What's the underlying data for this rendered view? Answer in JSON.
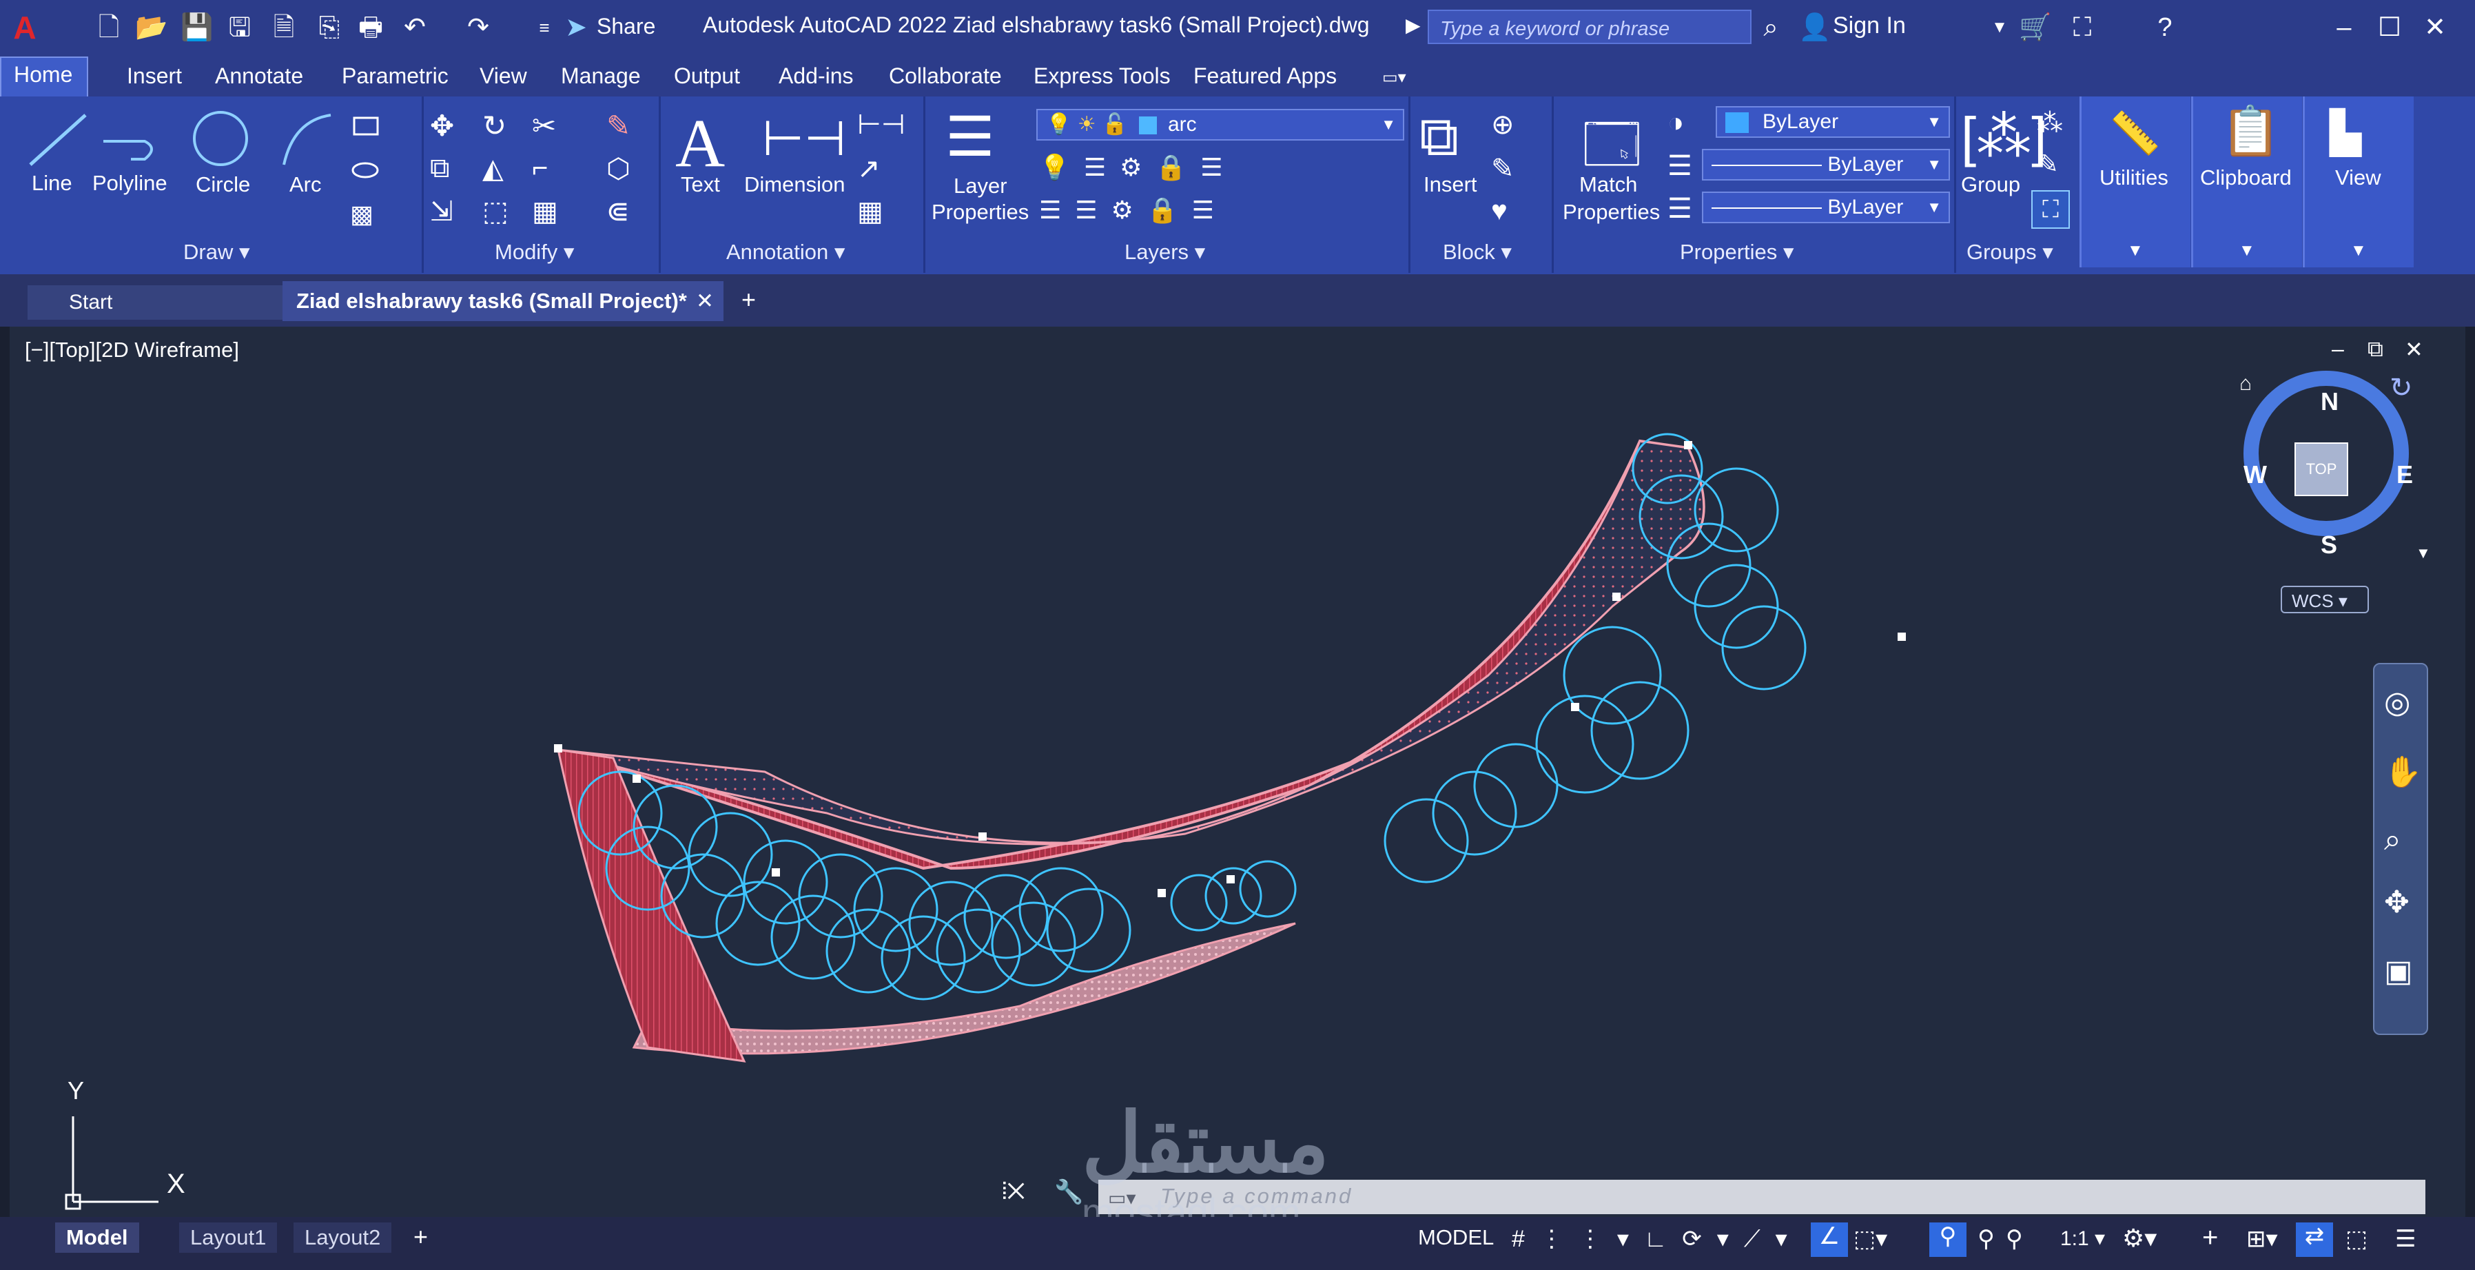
{
  "app": {
    "title": "Autodesk AutoCAD 2022   Ziad elshabrawy task6 (Small Project).dwg",
    "share_label": "Share",
    "search_placeholder": "Type a keyword or phrase",
    "signin_label": "Sign In"
  },
  "menu": [
    "Home",
    "Insert",
    "Annotate",
    "Parametric",
    "View",
    "Manage",
    "Output",
    "Add-ins",
    "Collaborate",
    "Express Tools",
    "Featured Apps"
  ],
  "ribbon": {
    "draw": {
      "title": "Draw",
      "line": "Line",
      "polyline": "Polyline",
      "circle": "Circle",
      "arc": "Arc"
    },
    "modify": {
      "title": "Modify"
    },
    "annotation": {
      "title": "Annotation",
      "text": "Text",
      "dimension": "Dimension"
    },
    "layers": {
      "title": "Layers",
      "layer_properties_1": "Layer",
      "layer_properties_2": "Properties",
      "current_layer": "arc"
    },
    "block": {
      "title": "Block",
      "insert": "Insert"
    },
    "properties": {
      "title": "Properties",
      "match_1": "Match",
      "match_2": "Properties",
      "color": "ByLayer",
      "linetype": "ByLayer",
      "lineweight": "ByLayer"
    },
    "groups": {
      "title": "Groups",
      "group": "Group"
    },
    "utilities": "Utilities",
    "clipboard": "Clipboard",
    "view": "View"
  },
  "doc_tabs": {
    "start": "Start",
    "active": "Ziad elshabrawy task6 (Small Project)*"
  },
  "viewport": {
    "label": "[−][Top][2D Wireframe]",
    "compass": {
      "n": "N",
      "s": "S",
      "e": "E",
      "w": "W",
      "top": "TOP",
      "wcs": "WCS"
    },
    "ucs": {
      "x": "X",
      "y": "Y"
    }
  },
  "command": {
    "placeholder": "Type a command"
  },
  "status": {
    "model_tab": "Model",
    "layout1": "Layout1",
    "layout2": "Layout2",
    "model": "MODEL",
    "scale": "1:1"
  },
  "watermark": {
    "arabic": "مستقل",
    "latin": "mostaql.com"
  }
}
